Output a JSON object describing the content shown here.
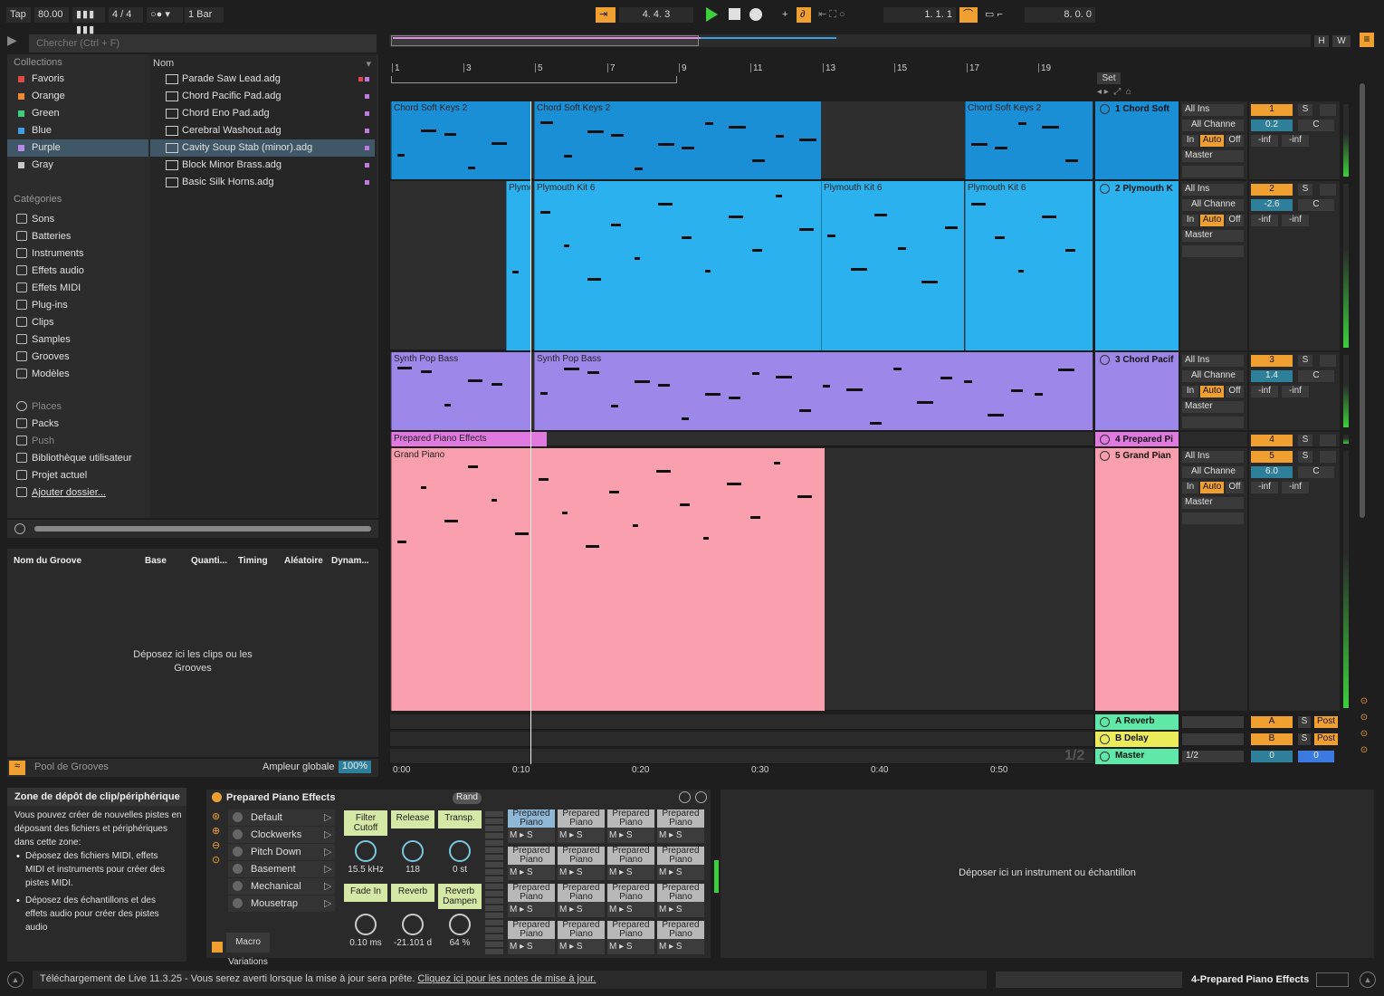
{
  "transport": {
    "tap": "Tap",
    "tempo": "80.00",
    "signature": "4 / 4",
    "quantize": "1 Bar",
    "position": "4.   4.   3",
    "loop_start": "1.   1.   1",
    "loop_length": "8.   0.   0"
  },
  "browser": {
    "search_placeholder": "Chercher (Ctrl + F)",
    "collections_header": "Collections",
    "collections": [
      {
        "label": "Favoris",
        "color": "#e04848"
      },
      {
        "label": "Orange",
        "color": "#f08a30"
      },
      {
        "label": "Green",
        "color": "#3ccf7a"
      },
      {
        "label": "Blue",
        "color": "#3c9de0"
      },
      {
        "label": "Purple",
        "color": "#b68ae6"
      },
      {
        "label": "Gray",
        "color": "#c8c8c8"
      }
    ],
    "categories_header": "Catégories",
    "categories": [
      "Sons",
      "Batteries",
      "Instruments",
      "Effets audio",
      "Effets MIDI",
      "Plug-ins",
      "Clips",
      "Samples",
      "Grooves",
      "Modèles"
    ],
    "places": [
      "Places",
      "Packs",
      "Push",
      "Bibliothèque utilisateur",
      "Projet actuel",
      "Ajouter dossier..."
    ],
    "name_header": "Nom",
    "files": [
      "Parade Saw Lead.adg",
      "Chord Pacific Pad.adg",
      "Chord Eno Pad.adg",
      "Cerebral Washout.adg",
      "Cavity Soup Stab (minor).adg",
      "Block Minor Brass.adg",
      "Basic Silk Horns.adg"
    ]
  },
  "groove": {
    "columns": [
      "Nom du Groove",
      "Base",
      "Quanti...",
      "Timing",
      "Aléatoire",
      "Dynam..."
    ],
    "drop_text": "Déposez ici les clips ou les Grooves",
    "pool": "Pool de Grooves",
    "global_amount_label": "Ampleur globale",
    "global_amount": "100%"
  },
  "arrangement": {
    "bars": [
      "1",
      "3",
      "5",
      "7",
      "9",
      "11",
      "13",
      "15",
      "17",
      "19"
    ],
    "set_label": "Set",
    "times": [
      "0:00",
      "0:10",
      "0:20",
      "0:30",
      "0:40",
      "0:50"
    ],
    "page": "1/2",
    "tracks": [
      {
        "name": "1 Chord Soft",
        "clips": [
          "Chord Soft Keys 2",
          "Chord Soft Keys 2",
          "Chord Soft Keys 2"
        ],
        "num": "1",
        "vol": "0.2",
        "pan": "C"
      },
      {
        "name": "2 Plymouth K",
        "clips": [
          "Plymo",
          "Plymouth Kit 6",
          "Plymouth Kit 6",
          "Plymouth Kit 6"
        ],
        "num": "2",
        "vol": "-2.6",
        "pan": "C"
      },
      {
        "name": "3 Chord Pacif",
        "clips": [
          "Synth Pop Bass",
          "Synth Pop Bass"
        ],
        "num": "3",
        "vol": "1.4",
        "pan": "C"
      },
      {
        "name": "4 Prepared Pi",
        "clips": [
          "Prepared Piano Effects"
        ],
        "num": "4"
      },
      {
        "name": "5 Grand Pian",
        "clips": [
          "Grand Piano"
        ],
        "num": "5",
        "vol": "6.0",
        "pan": "C"
      }
    ],
    "returns": [
      {
        "name": "A Reverb",
        "num": "A",
        "post": "Post"
      },
      {
        "name": "B Delay",
        "num": "B",
        "post": "Post"
      },
      {
        "name": "Master",
        "num": "0",
        "out": "1/2",
        "vol": "0"
      }
    ],
    "io": {
      "all_ins": "All Ins",
      "all_channels": "All Channe",
      "in": "In",
      "auto": "Auto",
      "off": "Off",
      "master": "Master",
      "inf": "-inf",
      "solo": "S"
    }
  },
  "devzone": {
    "title": "Zone de dépôt de clip/périphérique",
    "text": "Vous pouvez créer de nouvelles pistes en déposant des fichiers et périphériques dans cette zone:",
    "bullet1": "Déposez des fichiers MIDI, effets MIDI et instruments pour créer des pistes MIDI.",
    "bullet2": "Déposez des échantillons et des effets audio pour créer des pistes audio"
  },
  "device": {
    "name": "Prepared Piano Effects",
    "rand": "Rand",
    "presets": [
      "Default",
      "Clockwerks",
      "Pitch Down",
      "Basement",
      "Mechanical",
      "Mousetrap"
    ],
    "macro_variations": "Macro Variations",
    "macros": [
      {
        "label": "Filter Cutoff",
        "value": "15.5 kHz"
      },
      {
        "label": "Release",
        "value": "118"
      },
      {
        "label": "Transp.",
        "value": "0 st"
      },
      {
        "label": "Fade In",
        "value": "0.10 ms"
      },
      {
        "label": "Reverb",
        "value": "-21.101 d"
      },
      {
        "label": "Reverb Dampen",
        "value": "64 %"
      }
    ],
    "pad_label": "Prepared Piano"
  },
  "instrument_drop": "Déposer ici un instrument ou échantillon",
  "status": {
    "message": "Téléchargement de Live 11.3.25 - Vous serez averti lorsque la mise à jour sera prête.",
    "link": "Cliquez ici pour les notes de mise à jour.",
    "selected": "4-Prepared Piano Effects"
  }
}
